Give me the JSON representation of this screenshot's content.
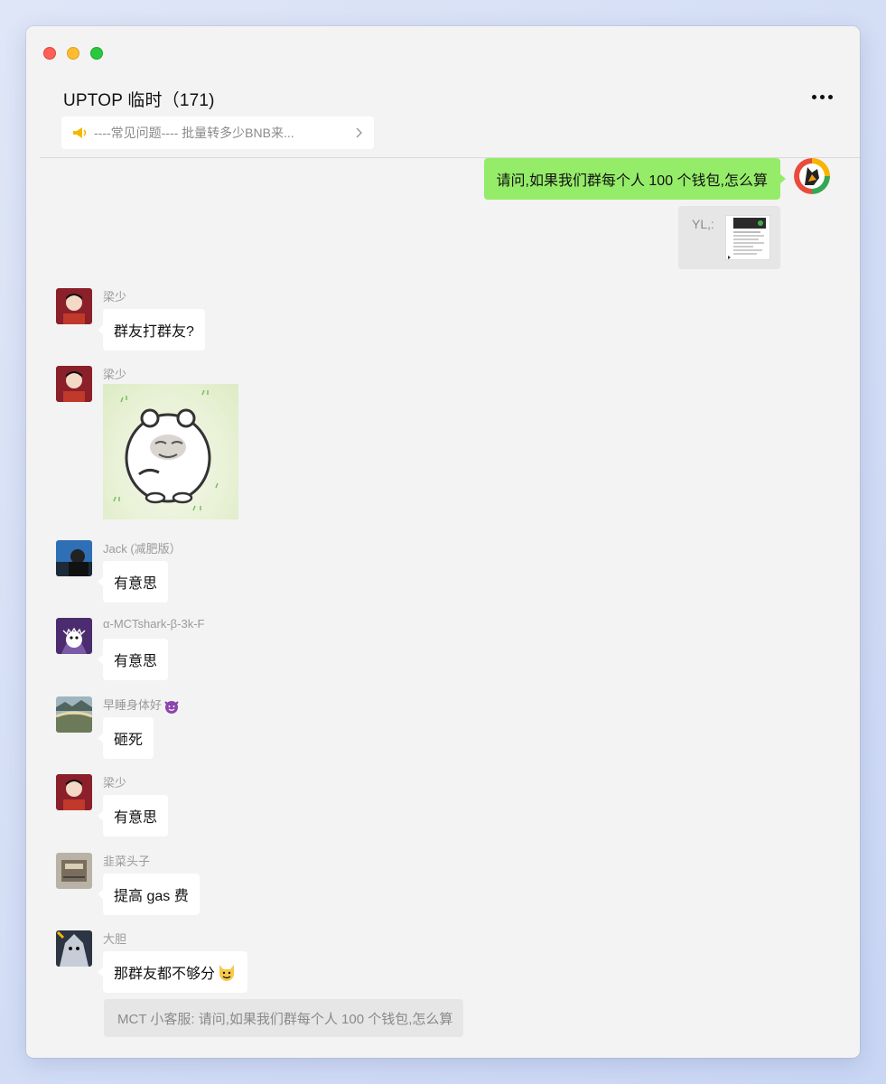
{
  "window": {
    "title": "UPTOP 临时（171)",
    "notice": "----常见问题---- 批量转多少BNB来..."
  },
  "self_message": {
    "text": "请问,如果我们群每个人 100 个钱包,怎么算",
    "quote_label": "YL,:"
  },
  "messages": [
    {
      "name": "梁少",
      "text": "群友打群友?"
    },
    {
      "name": "梁少",
      "sticker": "bear-sticker"
    },
    {
      "name": "Jack (减肥版）",
      "text": "有意思"
    },
    {
      "name": "α-MCTshark-β-3k-F",
      "text": "有意思"
    },
    {
      "name": "早睡身体好",
      "name_emoji": "smiling-devil-emoji",
      "text": "砸死"
    },
    {
      "name": "梁少",
      "text": "有意思"
    },
    {
      "name": "韭菜头子",
      "text": "提高 gas 费"
    },
    {
      "name": "大胆",
      "text": "那群友都不够分",
      "text_emoji": "cat-emoji"
    }
  ],
  "quoted_reply": "MCT 小客服: 请问,如果我们群每个人 100 个钱包,怎么算",
  "colors": {
    "self_bubble": "#95ec69",
    "other_bubble": "#ffffff",
    "window_bg": "#f3f3f3",
    "quote_bg": "#e6e6e6"
  }
}
